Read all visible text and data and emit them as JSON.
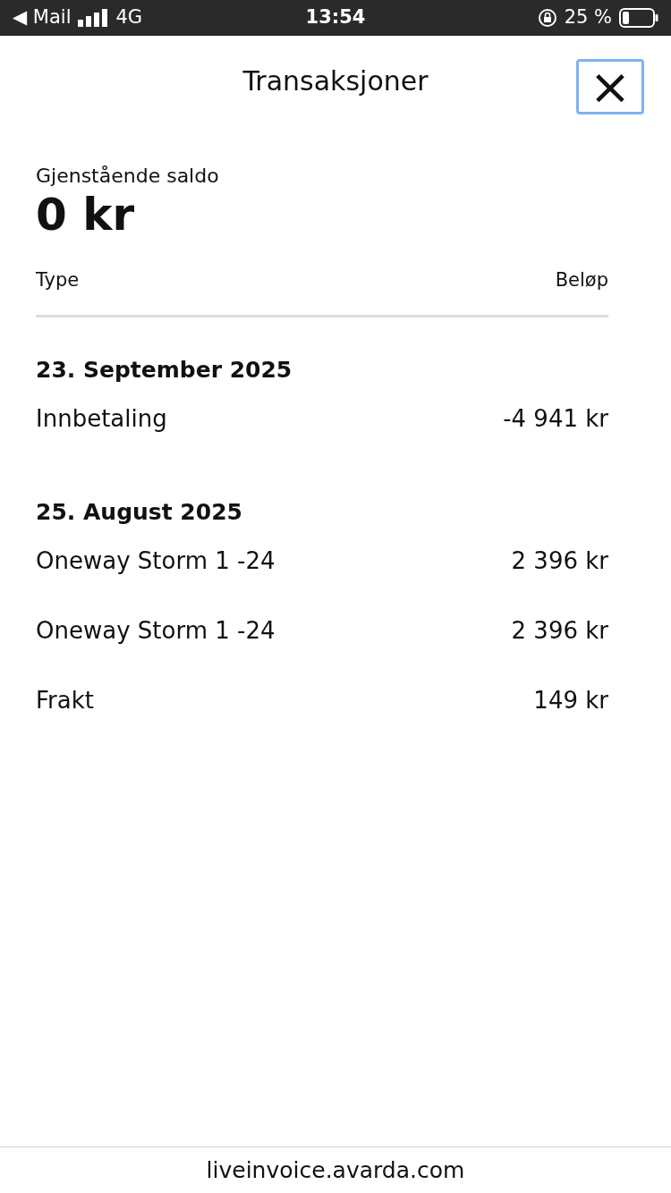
{
  "status_bar": {
    "back_label": "◀ Mail",
    "network": "4G",
    "time": "13:54",
    "battery_text": "25 %"
  },
  "header": {
    "title": "Transaksjoner",
    "close_button": {
      "label": "×",
      "focused": true
    }
  },
  "balance": {
    "label": "Gjenstående saldo",
    "amount": "0 kr"
  },
  "table": {
    "columns": [
      "Type",
      "Beløp"
    ],
    "groups": [
      {
        "date": "23. September 2025",
        "rows": [
          {
            "type": "Innbetaling",
            "amount": "-4 941 kr"
          }
        ]
      },
      {
        "date": "25. August 2025",
        "rows": [
          {
            "type": "Oneway Storm 1 -24",
            "amount": "2 396 kr"
          },
          {
            "type": "Oneway Storm 1 -24",
            "amount": "2 396 kr"
          },
          {
            "type": "Frakt",
            "amount": "149 kr"
          }
        ]
      }
    ]
  },
  "address_bar": {
    "url": "liveinvoice.avarda.com"
  }
}
